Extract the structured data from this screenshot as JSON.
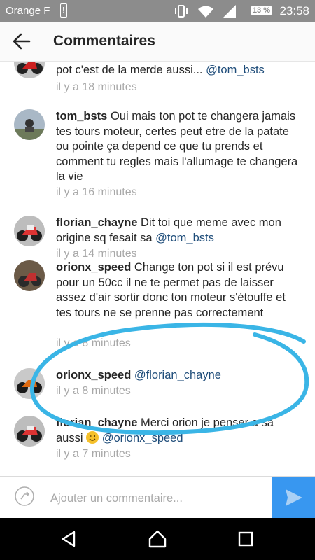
{
  "status_bar": {
    "carrier": "Orange F",
    "warning": "!",
    "battery": "13 %",
    "time": "23:58",
    "icons": [
      "vibrate-icon",
      "wifi-icon",
      "signal-icon"
    ]
  },
  "header": {
    "title": "Commentaires"
  },
  "comments": [
    {
      "username": "",
      "text": "pot c'est de la merde aussi... ",
      "mention": "@tom_bsts",
      "time": "il y a 18 minutes"
    },
    {
      "username": "tom_bsts",
      "text": " Oui mais ton pot te changera jamais tes tours moteur, certes peut etre de la patate ou pointe ça depend ce que tu prends et comment tu regles mais l'allumage te changera la vie",
      "mention": "",
      "time": "il y a 16 minutes"
    },
    {
      "username": "florian_chayne",
      "text": " Dit toi que meme avec mon origine sq fesait sa ",
      "mention": "@tom_bsts",
      "time": "il y a 14 minutes"
    },
    {
      "username": "orionx_speed",
      "text": " Change ton pot si il est prévu pour un 50cc il ne te permet pas de laisser assez d'air sortir donc ton moteur s'étouffe et tes tours ne se prenne pas correctement",
      "mention": "",
      "time": "il y a 8 minutes"
    },
    {
      "username": "orionx_speed",
      "text": " ",
      "mention": "@florian_chayne",
      "time": "il y a 8 minutes"
    },
    {
      "username": "florian_chayne",
      "text": " Merci orion je penser a sa aussi ",
      "mention": "@orionx_speed",
      "emoji": "wink-emoji",
      "time": "il y a 7 minutes"
    }
  ],
  "composer": {
    "placeholder": "Ajouter un commentaire..."
  },
  "colors": {
    "accent": "#3897f0",
    "mention": "#1f4d7a",
    "annotation": "#3ab5e6",
    "status_bar": "#8c8c8c"
  }
}
